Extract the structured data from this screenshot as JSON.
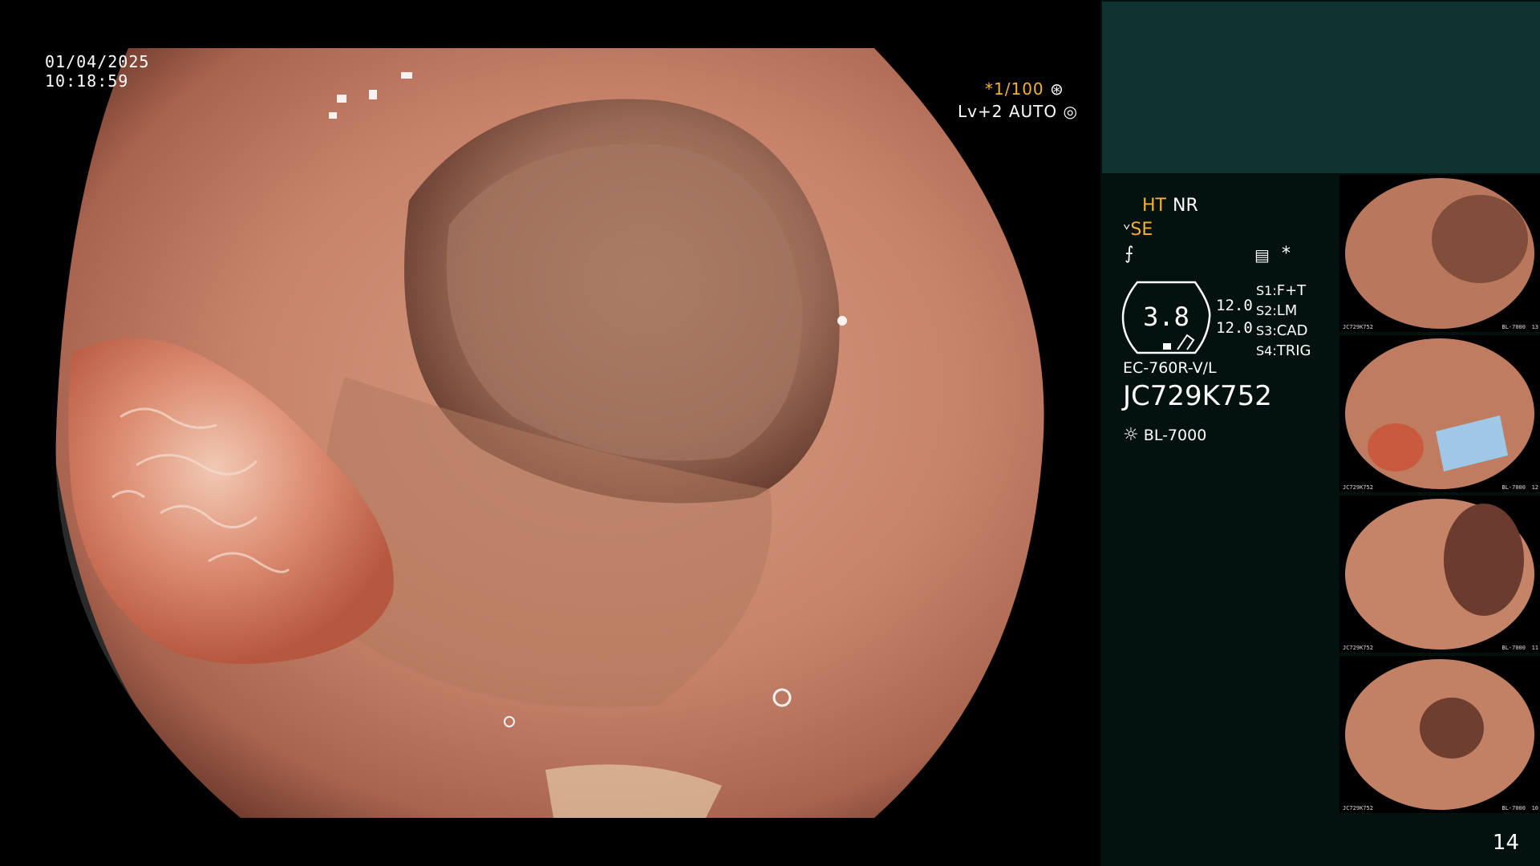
{
  "overlay": {
    "date": "01/04/2025",
    "time": "10:18:59",
    "shutter": "*1/100",
    "level": "Lv+2 AUTO"
  },
  "panel": {
    "ht": "HT",
    "nr": "NR",
    "se": "SE",
    "gauge_value": "3.8",
    "value_a": "12.0",
    "value_b": "12.0",
    "s1_key": "S1:",
    "s1_val": "F+T",
    "s2_key": "S2:",
    "s2_val": "LM",
    "s3_key": "S3:",
    "s3_val": "CAD",
    "s4_key": "S4:",
    "s4_val": "TRIG",
    "scope_model": "EC-760R-V/L",
    "serial": "JC729K752",
    "light_source": "BL-7000",
    "asterisk": "*"
  },
  "thumbnails": [
    {
      "caption": "JC729K752",
      "index": "13",
      "source": "BL-7000"
    },
    {
      "caption": "JC729K752",
      "index": "12",
      "source": "BL-7000"
    },
    {
      "caption": "JC729K752",
      "index": "11",
      "source": "BL-7000"
    },
    {
      "caption": "JC729K752",
      "index": "10",
      "source": "BL-7000"
    }
  ],
  "page_number": "14",
  "colors": {
    "panel_bg": "#04120f",
    "panel_top_bg": "#0f3330",
    "accent_yellow": "#f2b233",
    "tissue": "#c9836a"
  }
}
